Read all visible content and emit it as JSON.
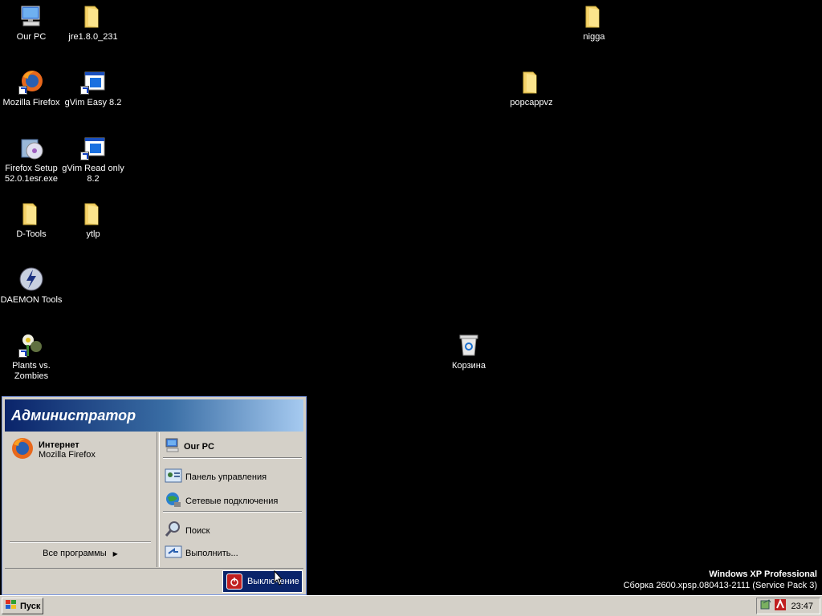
{
  "desktop": {
    "icons": [
      {
        "label": "Our PC",
        "icon": "computer-icon"
      },
      {
        "label": "jre1.8.0_231",
        "icon": "folder-icon"
      },
      {
        "label": "nigga",
        "icon": "folder-icon"
      },
      {
        "label": "Mozilla Firefox",
        "icon": "firefox-icon"
      },
      {
        "label": "gVim Easy 8.2",
        "icon": "gvim-icon"
      },
      {
        "label": "popcappvz",
        "icon": "folder-icon"
      },
      {
        "label": "Firefox Setup 52.0.1esr.exe",
        "icon": "installer-icon"
      },
      {
        "label": "gVim Read only 8.2",
        "icon": "gvim-icon"
      },
      {
        "label": "D-Tools",
        "icon": "folder-icon"
      },
      {
        "label": "ytlp",
        "icon": "folder-icon"
      },
      {
        "label": "DAEMON Tools",
        "icon": "daemon-tools-icon"
      },
      {
        "label": "Plants vs. Zombies",
        "icon": "plants-vs-zombies-icon"
      },
      {
        "label": "Корзина",
        "icon": "recycle-bin-icon"
      }
    ]
  },
  "start_menu": {
    "user": "Администратор",
    "pinned": {
      "title": "Интернет",
      "subtitle": "Mozilla Firefox"
    },
    "all_programs": "Все программы",
    "right_items": [
      {
        "label": "Our PC"
      },
      {
        "label": "Панель управления"
      },
      {
        "label": "Сетевые подключения"
      },
      {
        "label": "Поиск"
      },
      {
        "label": "Выполнить..."
      }
    ],
    "shutdown": "Выключение"
  },
  "taskbar": {
    "start_label": "Пуск",
    "clock": "23:47"
  },
  "watermark": {
    "edition": "Windows XP Professional",
    "build": "Сборка 2600.xpsp.080413-2111 (Service Pack 3)"
  },
  "colors": {
    "desktop_bg": "#000000",
    "menu_bg": "#d4d0c8",
    "header_start": "#0a246a",
    "header_end": "#a6caf0",
    "shutdown_red": "#c02020"
  }
}
